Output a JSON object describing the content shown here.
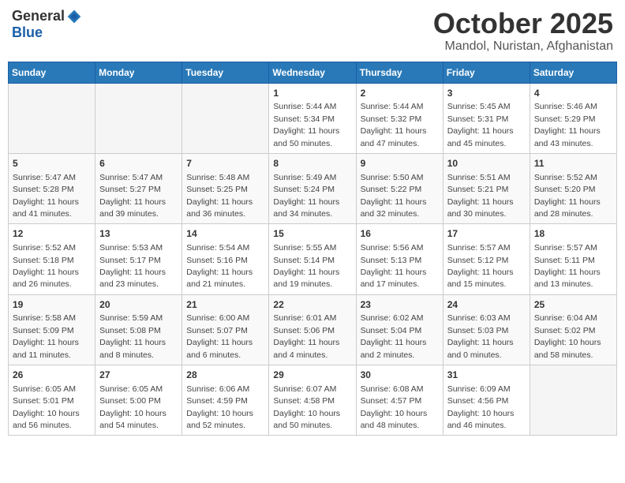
{
  "logo": {
    "general": "General",
    "blue": "Blue"
  },
  "header": {
    "month": "October 2025",
    "location": "Mandol, Nuristan, Afghanistan"
  },
  "weekdays": [
    "Sunday",
    "Monday",
    "Tuesday",
    "Wednesday",
    "Thursday",
    "Friday",
    "Saturday"
  ],
  "weeks": [
    [
      {
        "day": "",
        "info": ""
      },
      {
        "day": "",
        "info": ""
      },
      {
        "day": "",
        "info": ""
      },
      {
        "day": "1",
        "info": "Sunrise: 5:44 AM\nSunset: 5:34 PM\nDaylight: 11 hours and 50 minutes."
      },
      {
        "day": "2",
        "info": "Sunrise: 5:44 AM\nSunset: 5:32 PM\nDaylight: 11 hours and 47 minutes."
      },
      {
        "day": "3",
        "info": "Sunrise: 5:45 AM\nSunset: 5:31 PM\nDaylight: 11 hours and 45 minutes."
      },
      {
        "day": "4",
        "info": "Sunrise: 5:46 AM\nSunset: 5:29 PM\nDaylight: 11 hours and 43 minutes."
      }
    ],
    [
      {
        "day": "5",
        "info": "Sunrise: 5:47 AM\nSunset: 5:28 PM\nDaylight: 11 hours and 41 minutes."
      },
      {
        "day": "6",
        "info": "Sunrise: 5:47 AM\nSunset: 5:27 PM\nDaylight: 11 hours and 39 minutes."
      },
      {
        "day": "7",
        "info": "Sunrise: 5:48 AM\nSunset: 5:25 PM\nDaylight: 11 hours and 36 minutes."
      },
      {
        "day": "8",
        "info": "Sunrise: 5:49 AM\nSunset: 5:24 PM\nDaylight: 11 hours and 34 minutes."
      },
      {
        "day": "9",
        "info": "Sunrise: 5:50 AM\nSunset: 5:22 PM\nDaylight: 11 hours and 32 minutes."
      },
      {
        "day": "10",
        "info": "Sunrise: 5:51 AM\nSunset: 5:21 PM\nDaylight: 11 hours and 30 minutes."
      },
      {
        "day": "11",
        "info": "Sunrise: 5:52 AM\nSunset: 5:20 PM\nDaylight: 11 hours and 28 minutes."
      }
    ],
    [
      {
        "day": "12",
        "info": "Sunrise: 5:52 AM\nSunset: 5:18 PM\nDaylight: 11 hours and 26 minutes."
      },
      {
        "day": "13",
        "info": "Sunrise: 5:53 AM\nSunset: 5:17 PM\nDaylight: 11 hours and 23 minutes."
      },
      {
        "day": "14",
        "info": "Sunrise: 5:54 AM\nSunset: 5:16 PM\nDaylight: 11 hours and 21 minutes."
      },
      {
        "day": "15",
        "info": "Sunrise: 5:55 AM\nSunset: 5:14 PM\nDaylight: 11 hours and 19 minutes."
      },
      {
        "day": "16",
        "info": "Sunrise: 5:56 AM\nSunset: 5:13 PM\nDaylight: 11 hours and 17 minutes."
      },
      {
        "day": "17",
        "info": "Sunrise: 5:57 AM\nSunset: 5:12 PM\nDaylight: 11 hours and 15 minutes."
      },
      {
        "day": "18",
        "info": "Sunrise: 5:57 AM\nSunset: 5:11 PM\nDaylight: 11 hours and 13 minutes."
      }
    ],
    [
      {
        "day": "19",
        "info": "Sunrise: 5:58 AM\nSunset: 5:09 PM\nDaylight: 11 hours and 11 minutes."
      },
      {
        "day": "20",
        "info": "Sunrise: 5:59 AM\nSunset: 5:08 PM\nDaylight: 11 hours and 8 minutes."
      },
      {
        "day": "21",
        "info": "Sunrise: 6:00 AM\nSunset: 5:07 PM\nDaylight: 11 hours and 6 minutes."
      },
      {
        "day": "22",
        "info": "Sunrise: 6:01 AM\nSunset: 5:06 PM\nDaylight: 11 hours and 4 minutes."
      },
      {
        "day": "23",
        "info": "Sunrise: 6:02 AM\nSunset: 5:04 PM\nDaylight: 11 hours and 2 minutes."
      },
      {
        "day": "24",
        "info": "Sunrise: 6:03 AM\nSunset: 5:03 PM\nDaylight: 11 hours and 0 minutes."
      },
      {
        "day": "25",
        "info": "Sunrise: 6:04 AM\nSunset: 5:02 PM\nDaylight: 10 hours and 58 minutes."
      }
    ],
    [
      {
        "day": "26",
        "info": "Sunrise: 6:05 AM\nSunset: 5:01 PM\nDaylight: 10 hours and 56 minutes."
      },
      {
        "day": "27",
        "info": "Sunrise: 6:05 AM\nSunset: 5:00 PM\nDaylight: 10 hours and 54 minutes."
      },
      {
        "day": "28",
        "info": "Sunrise: 6:06 AM\nSunset: 4:59 PM\nDaylight: 10 hours and 52 minutes."
      },
      {
        "day": "29",
        "info": "Sunrise: 6:07 AM\nSunset: 4:58 PM\nDaylight: 10 hours and 50 minutes."
      },
      {
        "day": "30",
        "info": "Sunrise: 6:08 AM\nSunset: 4:57 PM\nDaylight: 10 hours and 48 minutes."
      },
      {
        "day": "31",
        "info": "Sunrise: 6:09 AM\nSunset: 4:56 PM\nDaylight: 10 hours and 46 minutes."
      },
      {
        "day": "",
        "info": ""
      }
    ]
  ]
}
